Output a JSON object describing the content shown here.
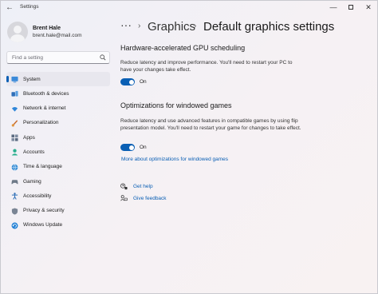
{
  "window": {
    "app_title": "Settings",
    "back_glyph": "←",
    "minimize_glyph": "—",
    "close_glyph": "✕"
  },
  "profile": {
    "name": "Brent Hale",
    "email": "brent.hale@mail.com"
  },
  "search": {
    "placeholder": "Find a setting"
  },
  "sidebar": {
    "items": [
      {
        "label": "System",
        "icon": "system-icon",
        "selected": true
      },
      {
        "label": "Bluetooth & devices",
        "icon": "bluetooth-icon"
      },
      {
        "label": "Network & internet",
        "icon": "wifi-icon"
      },
      {
        "label": "Personalization",
        "icon": "brush-icon"
      },
      {
        "label": "Apps",
        "icon": "apps-icon"
      },
      {
        "label": "Accounts",
        "icon": "accounts-icon"
      },
      {
        "label": "Time & language",
        "icon": "globe-icon"
      },
      {
        "label": "Gaming",
        "icon": "gaming-icon"
      },
      {
        "label": "Accessibility",
        "icon": "accessibility-icon"
      },
      {
        "label": "Privacy & security",
        "icon": "shield-icon"
      },
      {
        "label": "Windows Update",
        "icon": "update-icon"
      }
    ]
  },
  "breadcrumb": {
    "overflow": "···",
    "separator": "›",
    "parent": "Graphics",
    "current": "Default graphics settings"
  },
  "main": {
    "gpu_scheduling": {
      "title": "Hardware-accelerated GPU scheduling",
      "description": "Reduce latency and improve performance. You'll need to restart your PC to have your changes take effect.",
      "toggle_state": "On"
    },
    "windowed_games": {
      "title": "Optimizations for windowed games",
      "description": "Reduce latency and use advanced features in compatible games by using flip presentation model. You'll need to restart your game for changes to take effect.",
      "toggle_state": "On",
      "more_link": "More about optimizations for windowed games"
    },
    "help": {
      "get_help": "Get help",
      "give_feedback": "Give feedback"
    }
  },
  "colors": {
    "accent": "#0a5fb4",
    "selected_nav_bg": "#e8e7ee"
  }
}
